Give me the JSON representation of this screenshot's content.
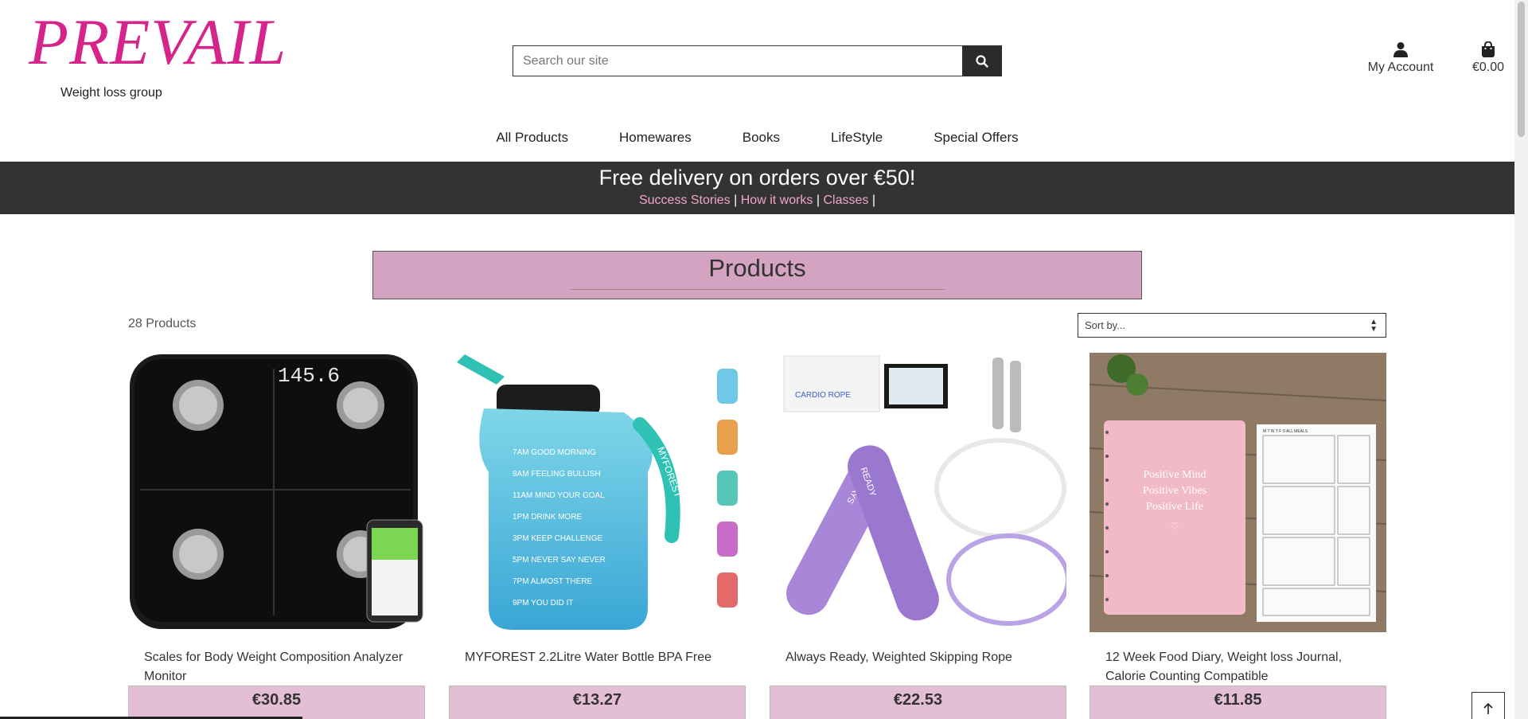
{
  "brand": {
    "name": "PREVAIL",
    "tagline": "Weight loss group",
    "color": "#d6258a"
  },
  "search": {
    "placeholder": "Search our site"
  },
  "account": {
    "label": "My Account"
  },
  "cart": {
    "total": "€0.00"
  },
  "nav": {
    "items": [
      "All Products",
      "Homewares",
      "Books",
      "LifeStyle",
      "Special Offers"
    ]
  },
  "banner": {
    "title": "Free delivery on orders over €50!",
    "links": [
      "Success Stories",
      "How it works",
      "Classes"
    ],
    "sep": "|"
  },
  "products": {
    "title": "Products",
    "count": "28 Products",
    "sort": {
      "selected": "Sort by..."
    },
    "items": [
      {
        "name": "Scales for Body Weight Composition Analyzer Monitor",
        "price": "€30.85"
      },
      {
        "name": "MYFOREST 2.2Litre Water Bottle BPA Free",
        "price": "€13.27"
      },
      {
        "name": "Always Ready, Weighted Skipping Rope",
        "price": "€22.53"
      },
      {
        "name": "12 Week Food Diary, Weight loss Journal, Calorie Counting Compatible",
        "price": "€11.85"
      }
    ]
  },
  "product_images": {
    "scale_display": "145.6",
    "bottle_lines": [
      "7AM GOOD MORNING",
      "9AM FEELING BULLISH",
      "11AM MIND YOUR GOAL",
      "1PM DRINK MORE",
      "3PM KEEP CHALLENGE",
      "5PM NEVER SAY NEVER",
      "7PM ALMOST THERE",
      "9PM YOU DID IT"
    ],
    "bottle_brand": "MYFOREST",
    "rope_box": "CARDIO ROPE",
    "rope_grip": [
      "ALWAYS",
      "READY"
    ],
    "diary_cover": [
      "Positive Mind",
      "Positive Vibes",
      "Positive Life"
    ],
    "diary_page_header": "M T W T F S  ALL MEALS"
  },
  "colors": {
    "accent_pink": "#d4a3c1",
    "price_pink": "#e4bed4",
    "banner_bg": "#333333",
    "link_pink": "#f0a6c9"
  }
}
